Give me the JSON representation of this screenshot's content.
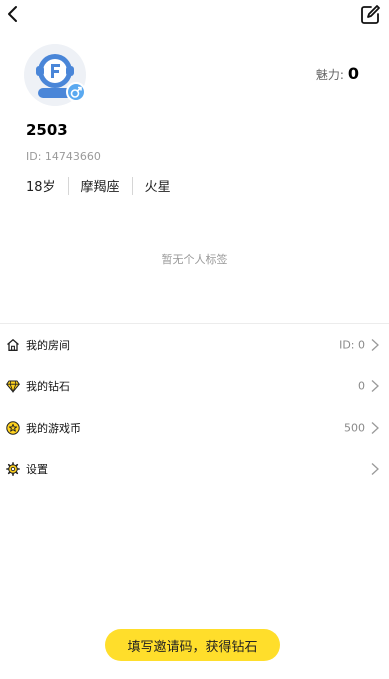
{
  "header": {
    "back_icon": "chevron-left-icon",
    "edit_icon": "edit-icon"
  },
  "profile": {
    "avatar_icon": "avatar-logo",
    "gender_icon": "male-icon",
    "charm_label": "魅力:",
    "charm_value": "0",
    "nickname": "2503",
    "id_text": "ID: 14743660",
    "tags": [
      "18岁",
      "摩羯座",
      "火星"
    ],
    "no_tags_text": "暂无个人标签"
  },
  "menu": [
    {
      "icon": "home-icon",
      "label": "我的房间",
      "value": "ID: 0"
    },
    {
      "icon": "diamond-icon",
      "label": "我的钻石",
      "value": "0"
    },
    {
      "icon": "star-coin-icon",
      "label": "我的游戏币",
      "value": "500"
    },
    {
      "icon": "gear-icon",
      "label": "设置",
      "value": ""
    }
  ],
  "invite_button": "填写邀请码，获得钻石",
  "colors": {
    "accent_yellow": "#ffde2b",
    "gender_blue": "#5aa9f0"
  }
}
